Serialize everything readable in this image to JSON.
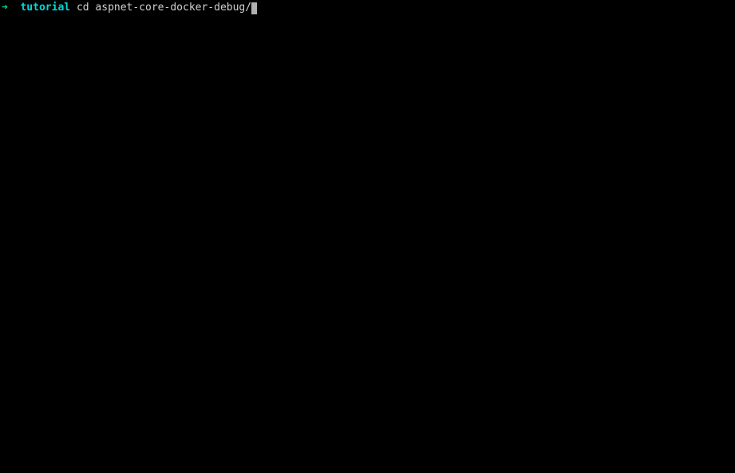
{
  "terminal": {
    "prompt": {
      "arrow": "➜",
      "context": "tutorial"
    },
    "command": "cd aspnet-core-docker-debug/"
  }
}
